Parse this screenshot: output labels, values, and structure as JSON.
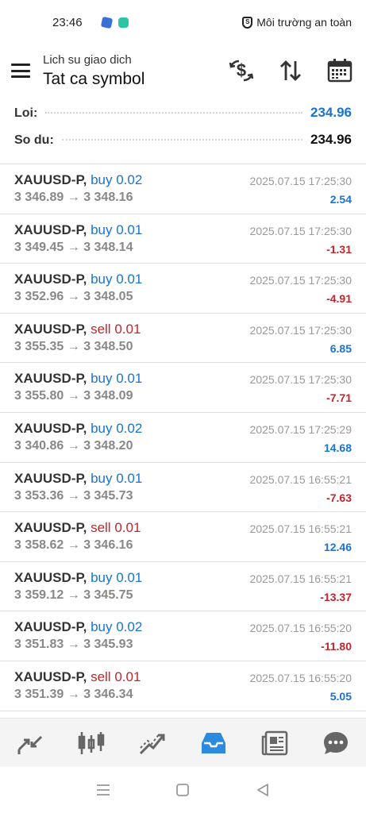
{
  "status_bar": {
    "time": "23:46",
    "safe_env_label": "Môi trường an toàn"
  },
  "header": {
    "subtitle": "Lich su giao dich",
    "title": "Tat ca symbol"
  },
  "summary": {
    "profit_label": "Loi:",
    "profit_value": "234.96",
    "balance_label": "So du:",
    "balance_value": "234.96"
  },
  "deals": [
    {
      "symbol": "XAUUSD-P,",
      "side": "buy",
      "volume": "0.02",
      "open": "3 346.89",
      "close": "3 348.16",
      "time": "2025.07.15 17:25:30",
      "profit": "2.54"
    },
    {
      "symbol": "XAUUSD-P,",
      "side": "buy",
      "volume": "0.01",
      "open": "3 349.45",
      "close": "3 348.14",
      "time": "2025.07.15 17:25:30",
      "profit": "-1.31"
    },
    {
      "symbol": "XAUUSD-P,",
      "side": "buy",
      "volume": "0.01",
      "open": "3 352.96",
      "close": "3 348.05",
      "time": "2025.07.15 17:25:30",
      "profit": "-4.91"
    },
    {
      "symbol": "XAUUSD-P,",
      "side": "sell",
      "volume": "0.01",
      "open": "3 355.35",
      "close": "3 348.50",
      "time": "2025.07.15 17:25:30",
      "profit": "6.85"
    },
    {
      "symbol": "XAUUSD-P,",
      "side": "buy",
      "volume": "0.01",
      "open": "3 355.80",
      "close": "3 348.09",
      "time": "2025.07.15 17:25:30",
      "profit": "-7.71"
    },
    {
      "symbol": "XAUUSD-P,",
      "side": "buy",
      "volume": "0.02",
      "open": "3 340.86",
      "close": "3 348.20",
      "time": "2025.07.15 17:25:29",
      "profit": "14.68"
    },
    {
      "symbol": "XAUUSD-P,",
      "side": "buy",
      "volume": "0.01",
      "open": "3 353.36",
      "close": "3 345.73",
      "time": "2025.07.15 16:55:21",
      "profit": "-7.63"
    },
    {
      "symbol": "XAUUSD-P,",
      "side": "sell",
      "volume": "0.01",
      "open": "3 358.62",
      "close": "3 346.16",
      "time": "2025.07.15 16:55:21",
      "profit": "12.46"
    },
    {
      "symbol": "XAUUSD-P,",
      "side": "buy",
      "volume": "0.01",
      "open": "3 359.12",
      "close": "3 345.75",
      "time": "2025.07.15 16:55:21",
      "profit": "-13.37"
    },
    {
      "symbol": "XAUUSD-P,",
      "side": "buy",
      "volume": "0.02",
      "open": "3 351.83",
      "close": "3 345.93",
      "time": "2025.07.15 16:55:20",
      "profit": "-11.80"
    },
    {
      "symbol": "XAUUSD-P,",
      "side": "sell",
      "volume": "0.01",
      "open": "3 351.39",
      "close": "3 346.34",
      "time": "2025.07.15 16:55:20",
      "profit": "5.05"
    }
  ],
  "arrow_glyph": "→",
  "colors": {
    "blue": "#1a73d1",
    "red": "#c0262d",
    "muted": "#888888",
    "active_tab": "#2c8be0"
  },
  "icons": {
    "header": [
      "currency-exchange-icon",
      "sort-icon",
      "calendar-icon"
    ],
    "bottom_nav": [
      "quotes-icon",
      "chart-icon",
      "trade-icon",
      "history-icon",
      "news-icon",
      "messages-icon"
    ],
    "active_tab": "history-icon"
  }
}
